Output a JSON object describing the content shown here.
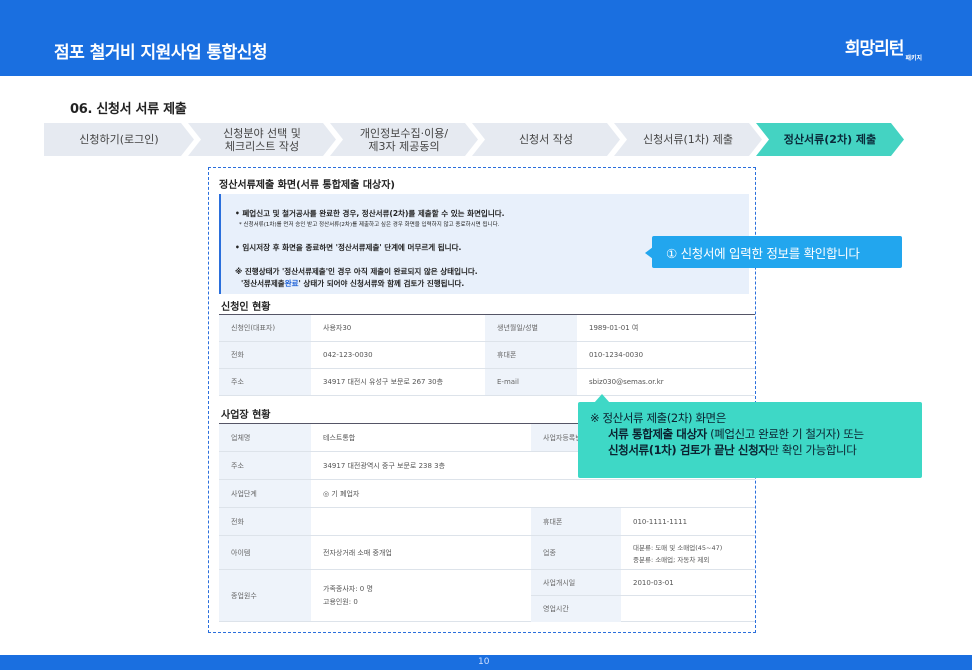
{
  "header": {
    "title": "점포 철거비 지원사업 통합신청",
    "logo": "희망리턴",
    "logo_sub": "패키지"
  },
  "section_title": "06. 신청서 서류 제출",
  "steps": [
    {
      "label": "신청하기(로그인)"
    },
    {
      "label": "신청분야 선택 및\n체크리스트 작성"
    },
    {
      "label": "개인정보수집·이용/\n제3자 제공동의"
    },
    {
      "label": "신청서 작성"
    },
    {
      "label": "신청서류(1차) 제출"
    },
    {
      "label": "정산서류(2차) 제출"
    }
  ],
  "screen": {
    "title": "정산서류제출 화면(서류 통합제출 대상자)",
    "notice": {
      "line1": "• 폐업신고 및 철거공사를 완료한 경우, 정산서류(2차)를 제출할 수 있는 화면입니다.",
      "line2": "* 신청서류(1차)를 먼저 승인 받고 정산서류(2차)를 제출하고 싶은 경우 화면을 입력하지 않고 종료하시면 됩니다.",
      "line3": "• 임시저장 후 화면을 종료하면 '정산서류제출' 단계에 머무르게 됩니다.",
      "line4": "※ 진행상태가 '정산서류제출'인 경우 아직 제출이 완료되지 않은 상태입니다.",
      "line5_a": "'정산서류제출",
      "line5_b": "완료",
      "line5_c": "' 상태가 되어야 신청서류와 함께 검토가 진행됩니다."
    },
    "applicant_title": "신청인 현황",
    "applicant": {
      "name_label": "신청인(대표자)",
      "name": "사용자30",
      "birth_label": "생년월일/성별",
      "birth": "1989-01-01 여",
      "phone_label": "전화",
      "phone": "042-123-0030",
      "mobile_label": "휴대폰",
      "mobile": "010-1234-0030",
      "addr_label": "주소",
      "addr": "34917 대전시 유성구 보문로 267 30층",
      "email_label": "E-mail",
      "email": "sbiz030@semas.or.kr"
    },
    "biz_title": "사업장 현황",
    "biz": {
      "company_label": "업체명",
      "company": "테스트통합",
      "regno_label": "사업자등록번",
      "addr_label": "주소",
      "addr": "34917 대전광역시 중구 보문로 238 3층",
      "stage_label": "사업단계",
      "stage": "◎ 기 폐업자",
      "phone_label": "전화",
      "phone": "",
      "mobile_label": "휴대폰",
      "mobile": "010-1111-1111",
      "item_label": "아이템",
      "item": "전자상거래 소매 중개업",
      "type_label": "업종",
      "type1": "대분류: 도매 및 소매업(45~47)",
      "type2": "중분류: 소매업; 자동차 제외",
      "employees_label": "종업원수",
      "employees1": "가족종사자: 0 명",
      "employees2": "고용인원: 0",
      "start_label": "사업개시일",
      "start": "2010-03-01",
      "hours_label": "영업시간",
      "hours": ""
    }
  },
  "callout1": {
    "text": "① 신청서에 입력한 정보를 확인합니다"
  },
  "callout2": {
    "line1": "※ 정산서류 제출(2차) 화면은",
    "line2_bold": "서류 통합제출 대상자",
    "line2_rest": " (폐업신고 완료한 기 철거자) 또는",
    "line3_bold": "신청서류(1차) 검토가 끝난 신청자",
    "line3_rest": "만 확인 가능합니다"
  },
  "footer": {
    "page": "10"
  }
}
